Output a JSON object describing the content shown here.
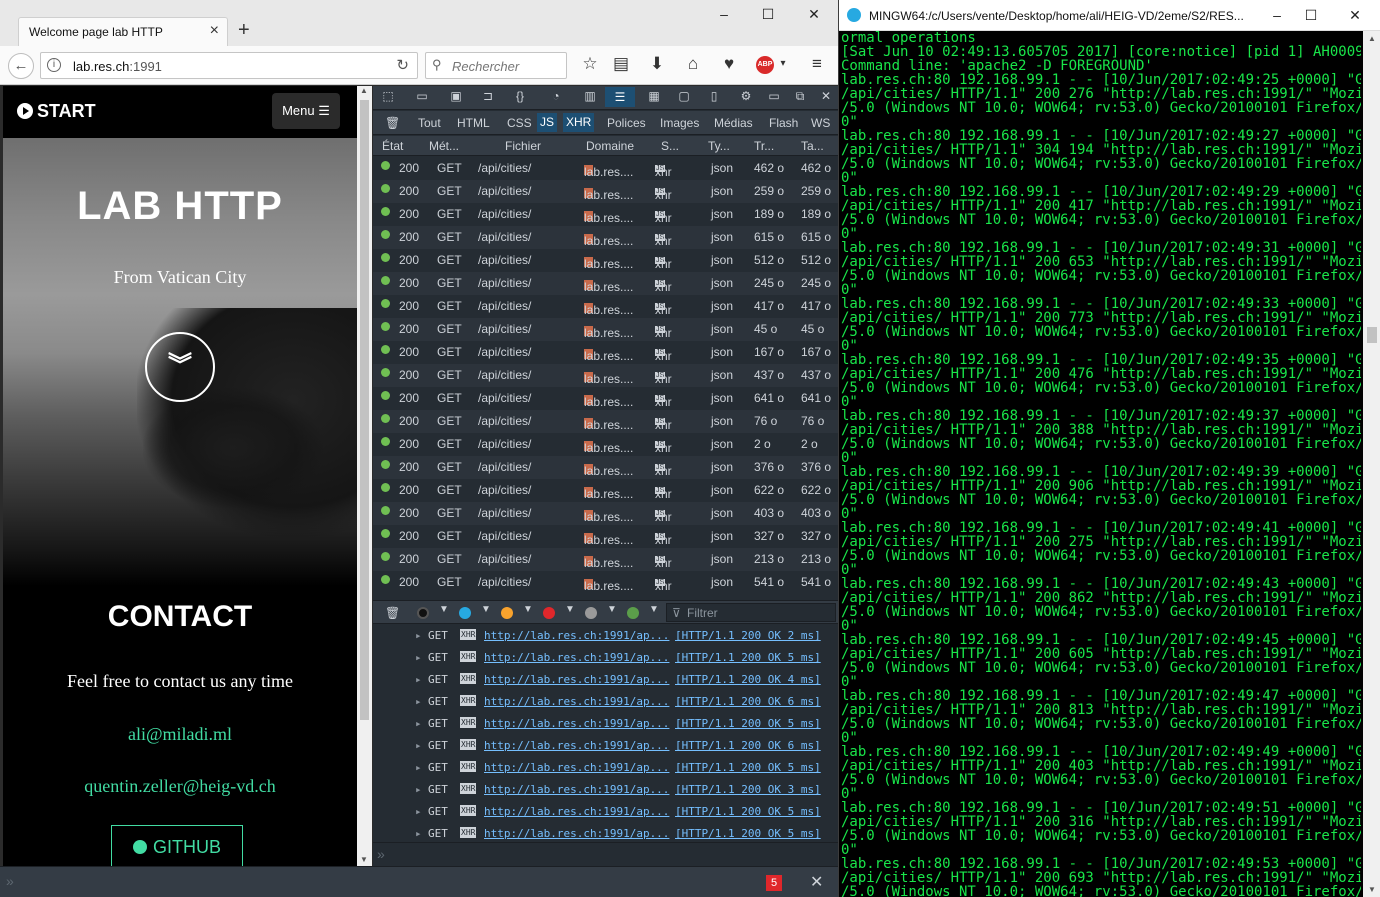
{
  "browser": {
    "tab_title": "Welcome page lab HTTP",
    "url_host": "lab.res.ch",
    "url_port": ":1991",
    "search_placeholder": "Rechercher",
    "abp_label": "ABP"
  },
  "page": {
    "brand": "START",
    "menu_label": "Menu",
    "hero_title": "LAB HTTP",
    "hero_subtitle": "From Vatican City",
    "contact_title": "CONTACT",
    "contact_text": "Feel free to contact us any time",
    "emails": [
      "ali@miladi.ml",
      "quentin.zeller@heig-vd.ch"
    ],
    "github_label": "GITHUB"
  },
  "devtools": {
    "filters": [
      "Tout",
      "HTML",
      "CSS",
      "JS",
      "XHR",
      "Polices",
      "Images",
      "Médias",
      "Flash",
      "WS"
    ],
    "selected_filters": [
      "JS",
      "XHR"
    ],
    "columns": [
      "État",
      "Mét...",
      "Fichier",
      "Domaine",
      "S...",
      "Ty...",
      "Tr...",
      "Ta..."
    ],
    "requests": [
      {
        "status": "200",
        "method": "GET",
        "file": "/api/cities/",
        "domain": "lab.res....",
        "cause": "xhr",
        "type": "json",
        "transferred": "462 o",
        "size": "462 o"
      },
      {
        "status": "200",
        "method": "GET",
        "file": "/api/cities/",
        "domain": "lab.res....",
        "cause": "xhr",
        "type": "json",
        "transferred": "259 o",
        "size": "259 o"
      },
      {
        "status": "200",
        "method": "GET",
        "file": "/api/cities/",
        "domain": "lab.res....",
        "cause": "xhr",
        "type": "json",
        "transferred": "189 o",
        "size": "189 o"
      },
      {
        "status": "200",
        "method": "GET",
        "file": "/api/cities/",
        "domain": "lab.res....",
        "cause": "xhr",
        "type": "json",
        "transferred": "615 o",
        "size": "615 o"
      },
      {
        "status": "200",
        "method": "GET",
        "file": "/api/cities/",
        "domain": "lab.res....",
        "cause": "xhr",
        "type": "json",
        "transferred": "512 o",
        "size": "512 o"
      },
      {
        "status": "200",
        "method": "GET",
        "file": "/api/cities/",
        "domain": "lab.res....",
        "cause": "xhr",
        "type": "json",
        "transferred": "245 o",
        "size": "245 o"
      },
      {
        "status": "200",
        "method": "GET",
        "file": "/api/cities/",
        "domain": "lab.res....",
        "cause": "xhr",
        "type": "json",
        "transferred": "417 o",
        "size": "417 o"
      },
      {
        "status": "200",
        "method": "GET",
        "file": "/api/cities/",
        "domain": "lab.res....",
        "cause": "xhr",
        "type": "json",
        "transferred": "45 o",
        "size": "45 o"
      },
      {
        "status": "200",
        "method": "GET",
        "file": "/api/cities/",
        "domain": "lab.res....",
        "cause": "xhr",
        "type": "json",
        "transferred": "167 o",
        "size": "167 o"
      },
      {
        "status": "200",
        "method": "GET",
        "file": "/api/cities/",
        "domain": "lab.res....",
        "cause": "xhr",
        "type": "json",
        "transferred": "437 o",
        "size": "437 o"
      },
      {
        "status": "200",
        "method": "GET",
        "file": "/api/cities/",
        "domain": "lab.res....",
        "cause": "xhr",
        "type": "json",
        "transferred": "641 o",
        "size": "641 o"
      },
      {
        "status": "200",
        "method": "GET",
        "file": "/api/cities/",
        "domain": "lab.res....",
        "cause": "xhr",
        "type": "json",
        "transferred": "76 o",
        "size": "76 o"
      },
      {
        "status": "200",
        "method": "GET",
        "file": "/api/cities/",
        "domain": "lab.res....",
        "cause": "xhr",
        "type": "json",
        "transferred": "2 o",
        "size": "2 o"
      },
      {
        "status": "200",
        "method": "GET",
        "file": "/api/cities/",
        "domain": "lab.res....",
        "cause": "xhr",
        "type": "json",
        "transferred": "376 o",
        "size": "376 o"
      },
      {
        "status": "200",
        "method": "GET",
        "file": "/api/cities/",
        "domain": "lab.res....",
        "cause": "xhr",
        "type": "json",
        "transferred": "622 o",
        "size": "622 o"
      },
      {
        "status": "200",
        "method": "GET",
        "file": "/api/cities/",
        "domain": "lab.res....",
        "cause": "xhr",
        "type": "json",
        "transferred": "403 o",
        "size": "403 o"
      },
      {
        "status": "200",
        "method": "GET",
        "file": "/api/cities/",
        "domain": "lab.res....",
        "cause": "xhr",
        "type": "json",
        "transferred": "327 o",
        "size": "327 o"
      },
      {
        "status": "200",
        "method": "GET",
        "file": "/api/cities/",
        "domain": "lab.res....",
        "cause": "xhr",
        "type": "json",
        "transferred": "213 o",
        "size": "213 o"
      },
      {
        "status": "200",
        "method": "GET",
        "file": "/api/cities/",
        "domain": "lab.res....",
        "cause": "xhr",
        "type": "json",
        "transferred": "541 o",
        "size": "541 o"
      }
    ],
    "console_filter_placeholder": "Filtrer",
    "console_lines": [
      {
        "method": "GET",
        "badge": "XHR",
        "url": "http://lab.res.ch:1991/ap...",
        "result": "[HTTP/1.1 200 OK 2 ms]"
      },
      {
        "method": "GET",
        "badge": "XHR",
        "url": "http://lab.res.ch:1991/ap...",
        "result": "[HTTP/1.1 200 OK 5 ms]"
      },
      {
        "method": "GET",
        "badge": "XHR",
        "url": "http://lab.res.ch:1991/ap...",
        "result": "[HTTP/1.1 200 OK 4 ms]"
      },
      {
        "method": "GET",
        "badge": "XHR",
        "url": "http://lab.res.ch:1991/ap...",
        "result": "[HTTP/1.1 200 OK 6 ms]"
      },
      {
        "method": "GET",
        "badge": "XHR",
        "url": "http://lab.res.ch:1991/ap...",
        "result": "[HTTP/1.1 200 OK 5 ms]"
      },
      {
        "method": "GET",
        "badge": "XHR",
        "url": "http://lab.res.ch:1991/ap...",
        "result": "[HTTP/1.1 200 OK 6 ms]"
      },
      {
        "method": "GET",
        "badge": "XHR",
        "url": "http://lab.res.ch:1991/ap...",
        "result": "[HTTP/1.1 200 OK 5 ms]"
      },
      {
        "method": "GET",
        "badge": "XHR",
        "url": "http://lab.res.ch:1991/ap...",
        "result": "[HTTP/1.1 200 OK 3 ms]"
      },
      {
        "method": "GET",
        "badge": "XHR",
        "url": "http://lab.res.ch:1991/ap...",
        "result": "[HTTP/1.1 200 OK 5 ms]"
      },
      {
        "method": "GET",
        "badge": "XHR",
        "url": "http://lab.res.ch:1991/ap...",
        "result": "[HTTP/1.1 200 OK 5 ms]"
      }
    ],
    "error_count": "5"
  },
  "terminal": {
    "title": "MINGW64:/c/Users/vente/Desktop/home/ali/HEIG-VD/2eme/S2/RES...",
    "lines": [
      "ormal operations",
      "[Sat Jun 10 02:49:13.605705 2017] [core:notice] [pid 1] AH00094:",
      "Command line: 'apache2 -D FOREGROUND'",
      "lab.res.ch:80 192.168.99.1 - - [10/Jun/2017:02:49:25 +0000] \"GET",
      "/api/cities/ HTTP/1.1\" 200 276 \"http://lab.res.ch:1991/\" \"Mozilla",
      "/5.0 (Windows NT 10.0; WOW64; rv:53.0) Gecko/20100101 Firefox/53.",
      "0\"",
      "lab.res.ch:80 192.168.99.1 - - [10/Jun/2017:02:49:27 +0000] \"GET",
      "/api/cities/ HTTP/1.1\" 304 194 \"http://lab.res.ch:1991/\" \"Mozilla",
      "/5.0 (Windows NT 10.0; WOW64; rv:53.0) Gecko/20100101 Firefox/53.",
      "0\"",
      "lab.res.ch:80 192.168.99.1 - - [10/Jun/2017:02:49:29 +0000] \"GET",
      "/api/cities/ HTTP/1.1\" 200 417 \"http://lab.res.ch:1991/\" \"Mozilla",
      "/5.0 (Windows NT 10.0; WOW64; rv:53.0) Gecko/20100101 Firefox/53.",
      "0\"",
      "lab.res.ch:80 192.168.99.1 - - [10/Jun/2017:02:49:31 +0000] \"GET",
      "/api/cities/ HTTP/1.1\" 200 653 \"http://lab.res.ch:1991/\" \"Mozilla",
      "/5.0 (Windows NT 10.0; WOW64; rv:53.0) Gecko/20100101 Firefox/53.",
      "0\"",
      "lab.res.ch:80 192.168.99.1 - - [10/Jun/2017:02:49:33 +0000] \"GET",
      "/api/cities/ HTTP/1.1\" 200 773 \"http://lab.res.ch:1991/\" \"Mozilla",
      "/5.0 (Windows NT 10.0; WOW64; rv:53.0) Gecko/20100101 Firefox/53.",
      "0\"",
      "lab.res.ch:80 192.168.99.1 - - [10/Jun/2017:02:49:35 +0000] \"GET",
      "/api/cities/ HTTP/1.1\" 200 476 \"http://lab.res.ch:1991/\" \"Mozilla",
      "/5.0 (Windows NT 10.0; WOW64; rv:53.0) Gecko/20100101 Firefox/53.",
      "0\"",
      "lab.res.ch:80 192.168.99.1 - - [10/Jun/2017:02:49:37 +0000] \"GET",
      "/api/cities/ HTTP/1.1\" 200 388 \"http://lab.res.ch:1991/\" \"Mozilla",
      "/5.0 (Windows NT 10.0; WOW64; rv:53.0) Gecko/20100101 Firefox/53.",
      "0\"",
      "lab.res.ch:80 192.168.99.1 - - [10/Jun/2017:02:49:39 +0000] \"GET",
      "/api/cities/ HTTP/1.1\" 200 906 \"http://lab.res.ch:1991/\" \"Mozilla",
      "/5.0 (Windows NT 10.0; WOW64; rv:53.0) Gecko/20100101 Firefox/53.",
      "0\"",
      "lab.res.ch:80 192.168.99.1 - - [10/Jun/2017:02:49:41 +0000] \"GET",
      "/api/cities/ HTTP/1.1\" 200 275 \"http://lab.res.ch:1991/\" \"Mozilla",
      "/5.0 (Windows NT 10.0; WOW64; rv:53.0) Gecko/20100101 Firefox/53.",
      "0\"",
      "lab.res.ch:80 192.168.99.1 - - [10/Jun/2017:02:49:43 +0000] \"GET",
      "/api/cities/ HTTP/1.1\" 200 862 \"http://lab.res.ch:1991/\" \"Mozilla",
      "/5.0 (Windows NT 10.0; WOW64; rv:53.0) Gecko/20100101 Firefox/53.",
      "0\"",
      "lab.res.ch:80 192.168.99.1 - - [10/Jun/2017:02:49:45 +0000] \"GET",
      "/api/cities/ HTTP/1.1\" 200 605 \"http://lab.res.ch:1991/\" \"Mozilla",
      "/5.0 (Windows NT 10.0; WOW64; rv:53.0) Gecko/20100101 Firefox/53.",
      "0\"",
      "lab.res.ch:80 192.168.99.1 - - [10/Jun/2017:02:49:47 +0000] \"GET",
      "/api/cities/ HTTP/1.1\" 200 813 \"http://lab.res.ch:1991/\" \"Mozilla",
      "/5.0 (Windows NT 10.0; WOW64; rv:53.0) Gecko/20100101 Firefox/53.",
      "0\"",
      "lab.res.ch:80 192.168.99.1 - - [10/Jun/2017:02:49:49 +0000] \"GET",
      "/api/cities/ HTTP/1.1\" 200 403 \"http://lab.res.ch:1991/\" \"Mozilla",
      "/5.0 (Windows NT 10.0; WOW64; rv:53.0) Gecko/20100101 Firefox/53.",
      "0\"",
      "lab.res.ch:80 192.168.99.1 - - [10/Jun/2017:02:49:51 +0000] \"GET",
      "/api/cities/ HTTP/1.1\" 200 316 \"http://lab.res.ch:1991/\" \"Mozilla",
      "/5.0 (Windows NT 10.0; WOW64; rv:53.0) Gecko/20100101 Firefox/53.",
      "0\"",
      "lab.res.ch:80 192.168.99.1 - - [10/Jun/2017:02:49:53 +0000] \"GET",
      "/api/cities/ HTTP/1.1\" 200 693 \"http://lab.res.ch:1991/\" \"Mozilla",
      "/5.0 (Windows NT 10.0; WOW64; rv:53.0) Gecko/20100101 Firefox/53."
    ]
  },
  "colors": {
    "terminal_text": "#19e64a",
    "accent_green": "#42dca3",
    "devtools_bg": "#252c33",
    "status_ok": "#70bf53"
  }
}
